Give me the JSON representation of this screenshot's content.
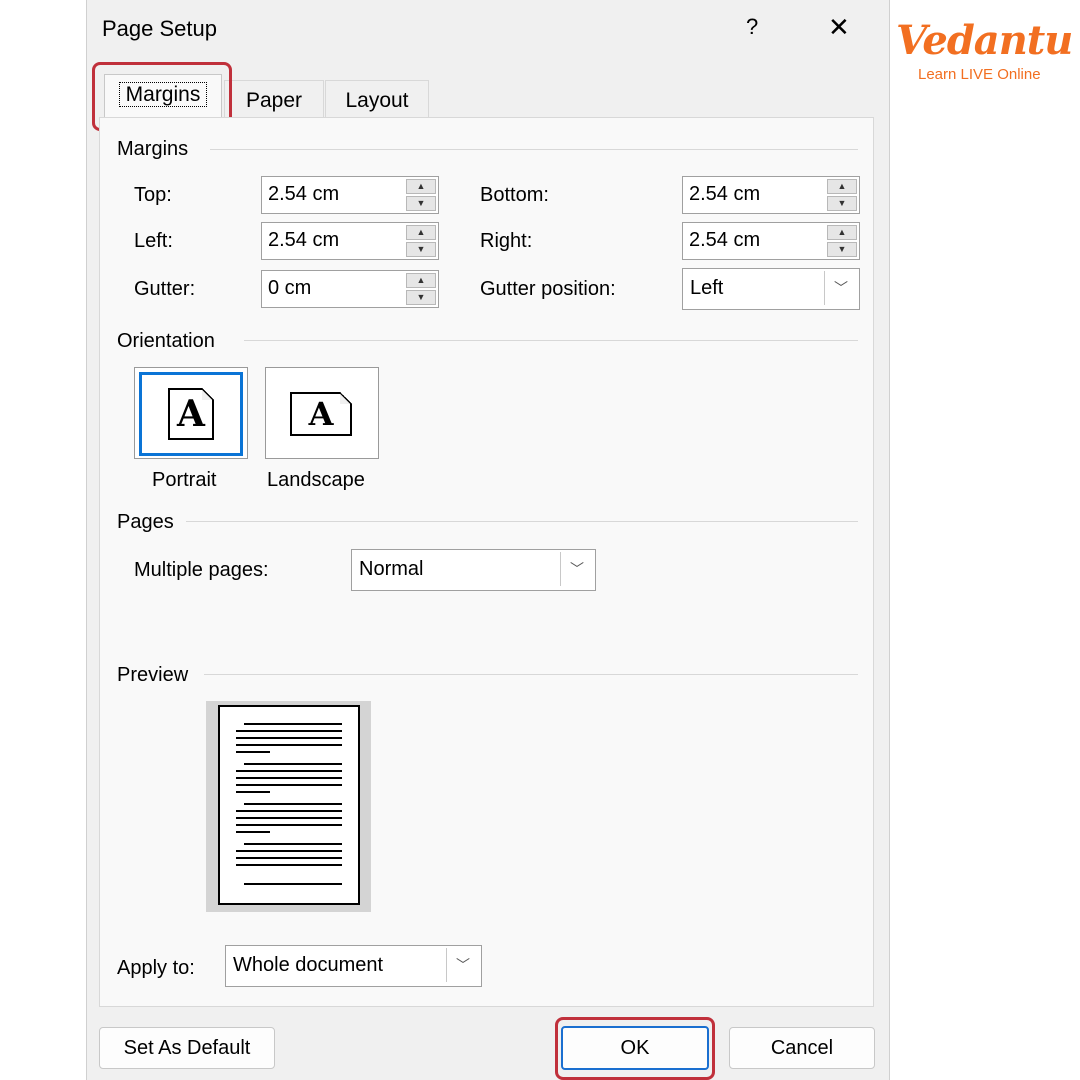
{
  "dialog": {
    "title": "Page Setup",
    "help": "?",
    "close": "✕"
  },
  "brand": {
    "name": "Vedantu",
    "tagline": "Learn LIVE Online",
    "color": "#f26f21"
  },
  "highlight_color": "#c0303b",
  "tabs": [
    {
      "label": "Margins",
      "active": true
    },
    {
      "label": "Paper",
      "active": false
    },
    {
      "label": "Layout",
      "active": false
    }
  ],
  "margins": {
    "heading": "Margins",
    "top": {
      "label": "Top:",
      "value": "2.54 cm"
    },
    "bottom": {
      "label": "Bottom:",
      "value": "2.54 cm"
    },
    "left": {
      "label": "Left:",
      "value": "2.54 cm"
    },
    "right": {
      "label": "Right:",
      "value": "2.54 cm"
    },
    "gutter": {
      "label": "Gutter:",
      "value": "0 cm"
    },
    "gutter_position": {
      "label": "Gutter position:",
      "value": "Left"
    }
  },
  "orientation": {
    "heading": "Orientation",
    "portrait": "Portrait",
    "landscape": "Landscape",
    "selected": "Portrait",
    "glyph": "A"
  },
  "pages": {
    "heading": "Pages",
    "multiple_label": "Multiple pages:",
    "multiple_value": "Normal"
  },
  "preview": {
    "heading": "Preview"
  },
  "apply": {
    "label": "Apply to:",
    "value": "Whole document"
  },
  "buttons": {
    "default": "Set As Default",
    "ok": "OK",
    "cancel": "Cancel"
  }
}
